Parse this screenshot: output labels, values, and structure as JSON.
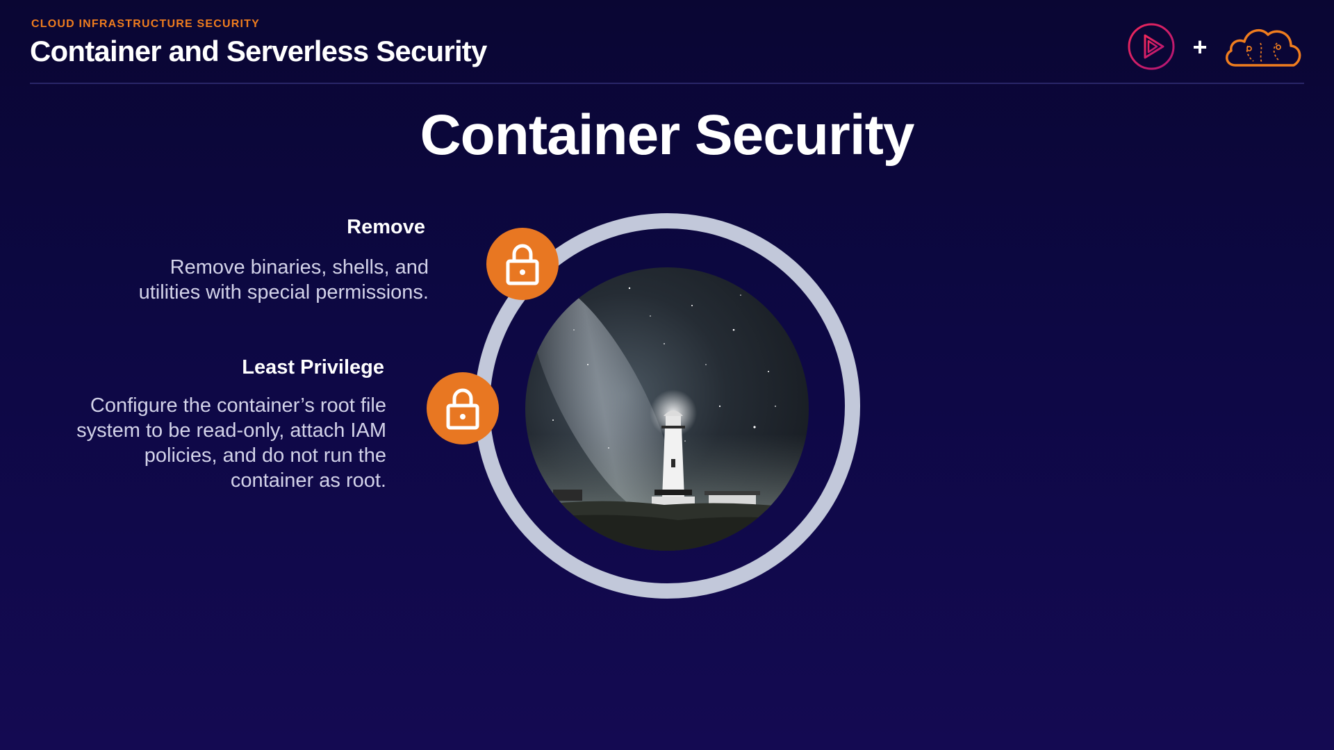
{
  "header": {
    "eyebrow": "CLOUD INFRASTRUCTURE SECURITY",
    "course_title": "Container and Serverless Security",
    "plus": "+",
    "brand_icon": "play-logo-icon",
    "partner_icon": "cloud-logo-icon"
  },
  "slide": {
    "title": "Container Security",
    "image": "lighthouse-night-sky",
    "items": [
      {
        "heading": "Remove",
        "body": "Remove binaries, shells, and utilities with special permissions.",
        "icon": "lock-icon"
      },
      {
        "heading": "Least Privilege",
        "body": "Configure the container’s root file system to be read-only, attach IAM policies, and do not run the container as root.",
        "icon": "lock-icon"
      }
    ]
  },
  "colors": {
    "background": "#0d0844",
    "accent_orange": "#e87722",
    "eyebrow_orange": "#f07d1e",
    "ring": "#c2c8da",
    "brand_pink": "#e5195f",
    "body_text": "#d3d3e9"
  }
}
